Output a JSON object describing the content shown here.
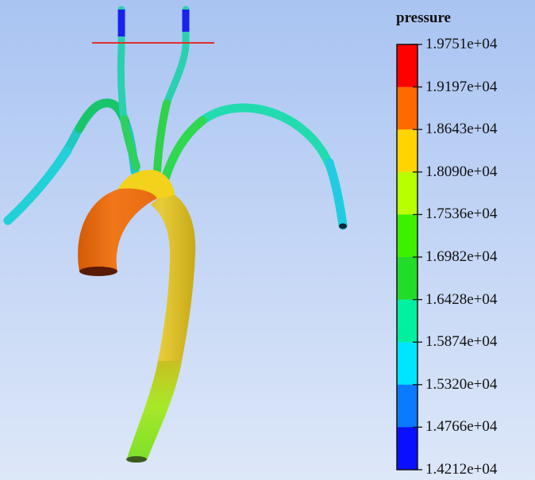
{
  "legend": {
    "title": "pressure",
    "labels": [
      "1.9751e+04",
      "1.9197e+04",
      "1.8643e+04",
      "1.8090e+04",
      "1.7536e+04",
      "1.6982e+04",
      "1.6428e+04",
      "1.5874e+04",
      "1.5320e+04",
      "1.4766e+04",
      "1.4212e+04"
    ],
    "colors_top_to_bottom": [
      "#ff0000",
      "#ff6a00",
      "#ffd400",
      "#b8ff00",
      "#3cf000",
      "#22dc2a",
      "#00f0a0",
      "#00e5ff",
      "#0a7aff",
      "#0a10ff"
    ]
  },
  "model_colors": {
    "arch": "#f06c10",
    "descending": "#d8c82a",
    "descending_lower": "#a8ee22",
    "outlet_end": "#4fe040",
    "junction": "#ffd21a",
    "vessel_mid": "#20e066",
    "vessel_light": "#35f09a",
    "vessel_cyan": "#1fd8d8",
    "vessel_blue": "#1a22ff",
    "cut_line": "#e0302a"
  }
}
